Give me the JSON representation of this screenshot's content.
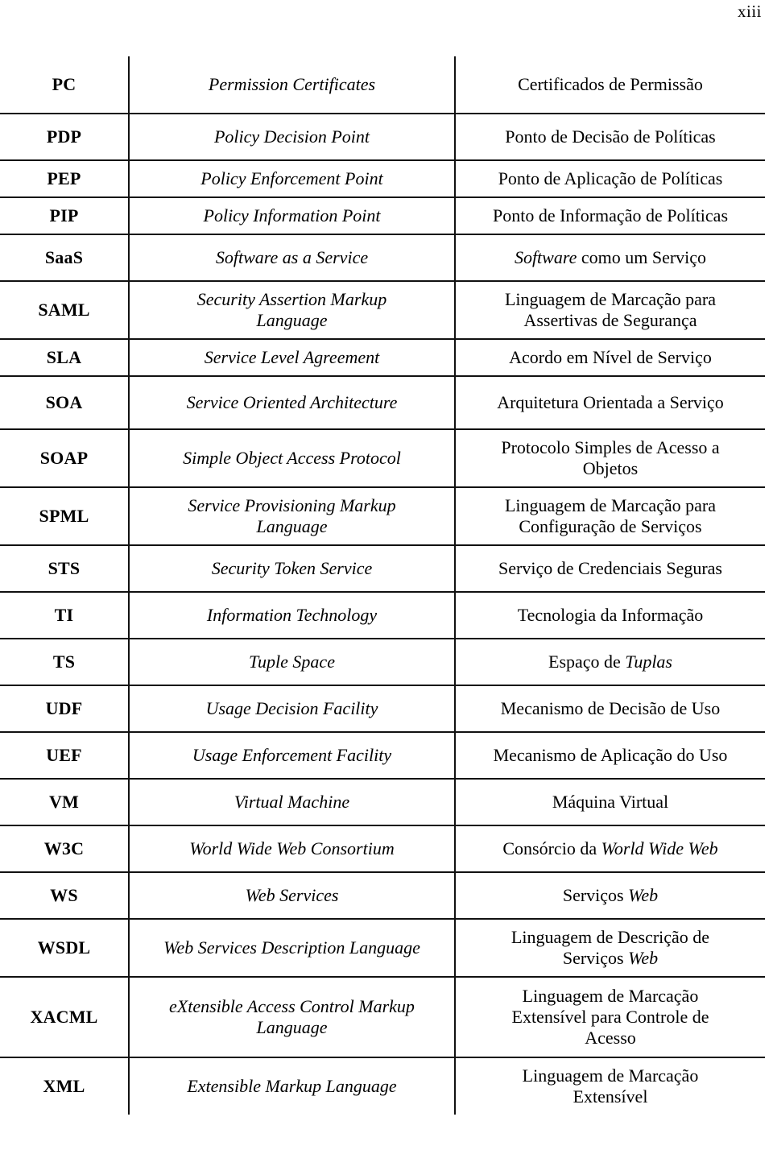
{
  "page": {
    "folio": "xiii"
  },
  "table": {
    "name": "glossary-of-acronyms",
    "rows": [
      {
        "abbr": "PC",
        "en": "Permission Certificates",
        "pt": "Certificados de Permissão",
        "size": "h2"
      },
      {
        "abbr": "PDP",
        "en": "Policy Decision Point",
        "pt": "Ponto de Decisão de Políticas",
        "size": "gap"
      },
      {
        "abbr": "PEP",
        "en": "Policy Enforcement Point",
        "pt": "Ponto de Aplicação de Políticas",
        "size": "h1"
      },
      {
        "abbr": "PIP",
        "en": "Policy Information Point",
        "pt": "Ponto de Informação de Políticas",
        "size": "h1"
      },
      {
        "abbr": "SaaS",
        "en": "Software as a Service",
        "pt_rich": [
          {
            "text": "Software",
            "italic": true
          },
          {
            "text": " como um Serviço",
            "italic": false
          }
        ],
        "pt": "Software como um Serviço",
        "size": "gap"
      },
      {
        "abbr": "SAML",
        "en": "Security Assertion Markup Language",
        "en_lines": [
          "Security Assertion Markup",
          "Language"
        ],
        "pt": "Linguagem de Marcação para Assertivas de Segurança",
        "pt_lines": [
          "Linguagem de Marcação para",
          "Assertivas de Segurança"
        ],
        "size": "h2"
      },
      {
        "abbr": "SLA",
        "en": "Service Level Agreement",
        "pt": "Acordo em Nível de Serviço",
        "size": "h1"
      },
      {
        "abbr": "SOA",
        "en": "Service Oriented Architecture",
        "pt": "Arquitetura Orientada a Serviço",
        "size": "gapbig"
      },
      {
        "abbr": "SOAP",
        "en": "Simple Object Access Protocol",
        "pt": "Protocolo Simples de Acesso a Objetos",
        "pt_lines": [
          "Protocolo Simples de Acesso a",
          "Objetos"
        ],
        "size": "h2"
      },
      {
        "abbr": "SPML",
        "en": "Service Provisioning Markup Language",
        "en_lines": [
          "Service Provisioning Markup",
          "Language"
        ],
        "pt": "Linguagem de Marcação para Configuração de Serviços",
        "pt_lines": [
          "Linguagem de Marcação para",
          "Configuração de Serviços"
        ],
        "size": "h2"
      },
      {
        "abbr": "STS",
        "en": "Security Token Service",
        "pt": "Serviço de Credenciais Seguras",
        "size": "gap"
      },
      {
        "abbr": "TI",
        "en": "Information Technology",
        "pt": "Tecnologia da Informação",
        "size": "gap"
      },
      {
        "abbr": "TS",
        "en": "Tuple Space",
        "pt_rich": [
          {
            "text": "Espaço de ",
            "italic": false
          },
          {
            "text": "Tuplas",
            "italic": true
          }
        ],
        "pt": "Espaço de Tuplas",
        "size": "gap"
      },
      {
        "abbr": "UDF",
        "en": "Usage Decision Facility",
        "pt": "Mecanismo de Decisão de Uso",
        "size": "gap"
      },
      {
        "abbr": "UEF",
        "en": "Usage Enforcement Facility",
        "pt": "Mecanismo de Aplicação do Uso",
        "size": "gap"
      },
      {
        "abbr": "VM",
        "en": "Virtual Machine",
        "pt": "Máquina Virtual",
        "size": "gap"
      },
      {
        "abbr": "W3C",
        "en": "World Wide Web Consortium",
        "pt_rich": [
          {
            "text": "Consórcio da ",
            "italic": false
          },
          {
            "text": "World Wide Web",
            "italic": true
          }
        ],
        "pt": "Consórcio da World Wide Web",
        "size": "gap"
      },
      {
        "abbr": "WS",
        "en": "Web Services",
        "pt_rich": [
          {
            "text": "Serviços ",
            "italic": false
          },
          {
            "text": "Web",
            "italic": true
          }
        ],
        "pt": "Serviços Web",
        "size": "gap"
      },
      {
        "abbr": "WSDL",
        "en": "Web Services Description Language",
        "pt": "Linguagem de Descrição de Serviços Web",
        "pt_rich_lines": [
          [
            {
              "text": "Linguagem de Descrição de",
              "italic": false
            }
          ],
          [
            {
              "text": "Serviços ",
              "italic": false
            },
            {
              "text": "Web",
              "italic": true
            }
          ]
        ],
        "size": "h2"
      },
      {
        "abbr": "XACML",
        "en": "eXtensible Access Control Markup Language",
        "en_lines": [
          "eXtensible Access Control Markup",
          "Language"
        ],
        "pt": "Linguagem de Marcação Extensível para Controle de Acesso",
        "pt_lines": [
          "Linguagem de Marcação",
          "Extensível para Controle de",
          "Acesso"
        ],
        "size": "h3"
      },
      {
        "abbr": "XML",
        "en": "Extensible Markup Language",
        "pt": "Linguagem de Marcação Extensível",
        "pt_lines": [
          "Linguagem de Marcação",
          "Extensível"
        ],
        "size": "h2"
      }
    ]
  }
}
